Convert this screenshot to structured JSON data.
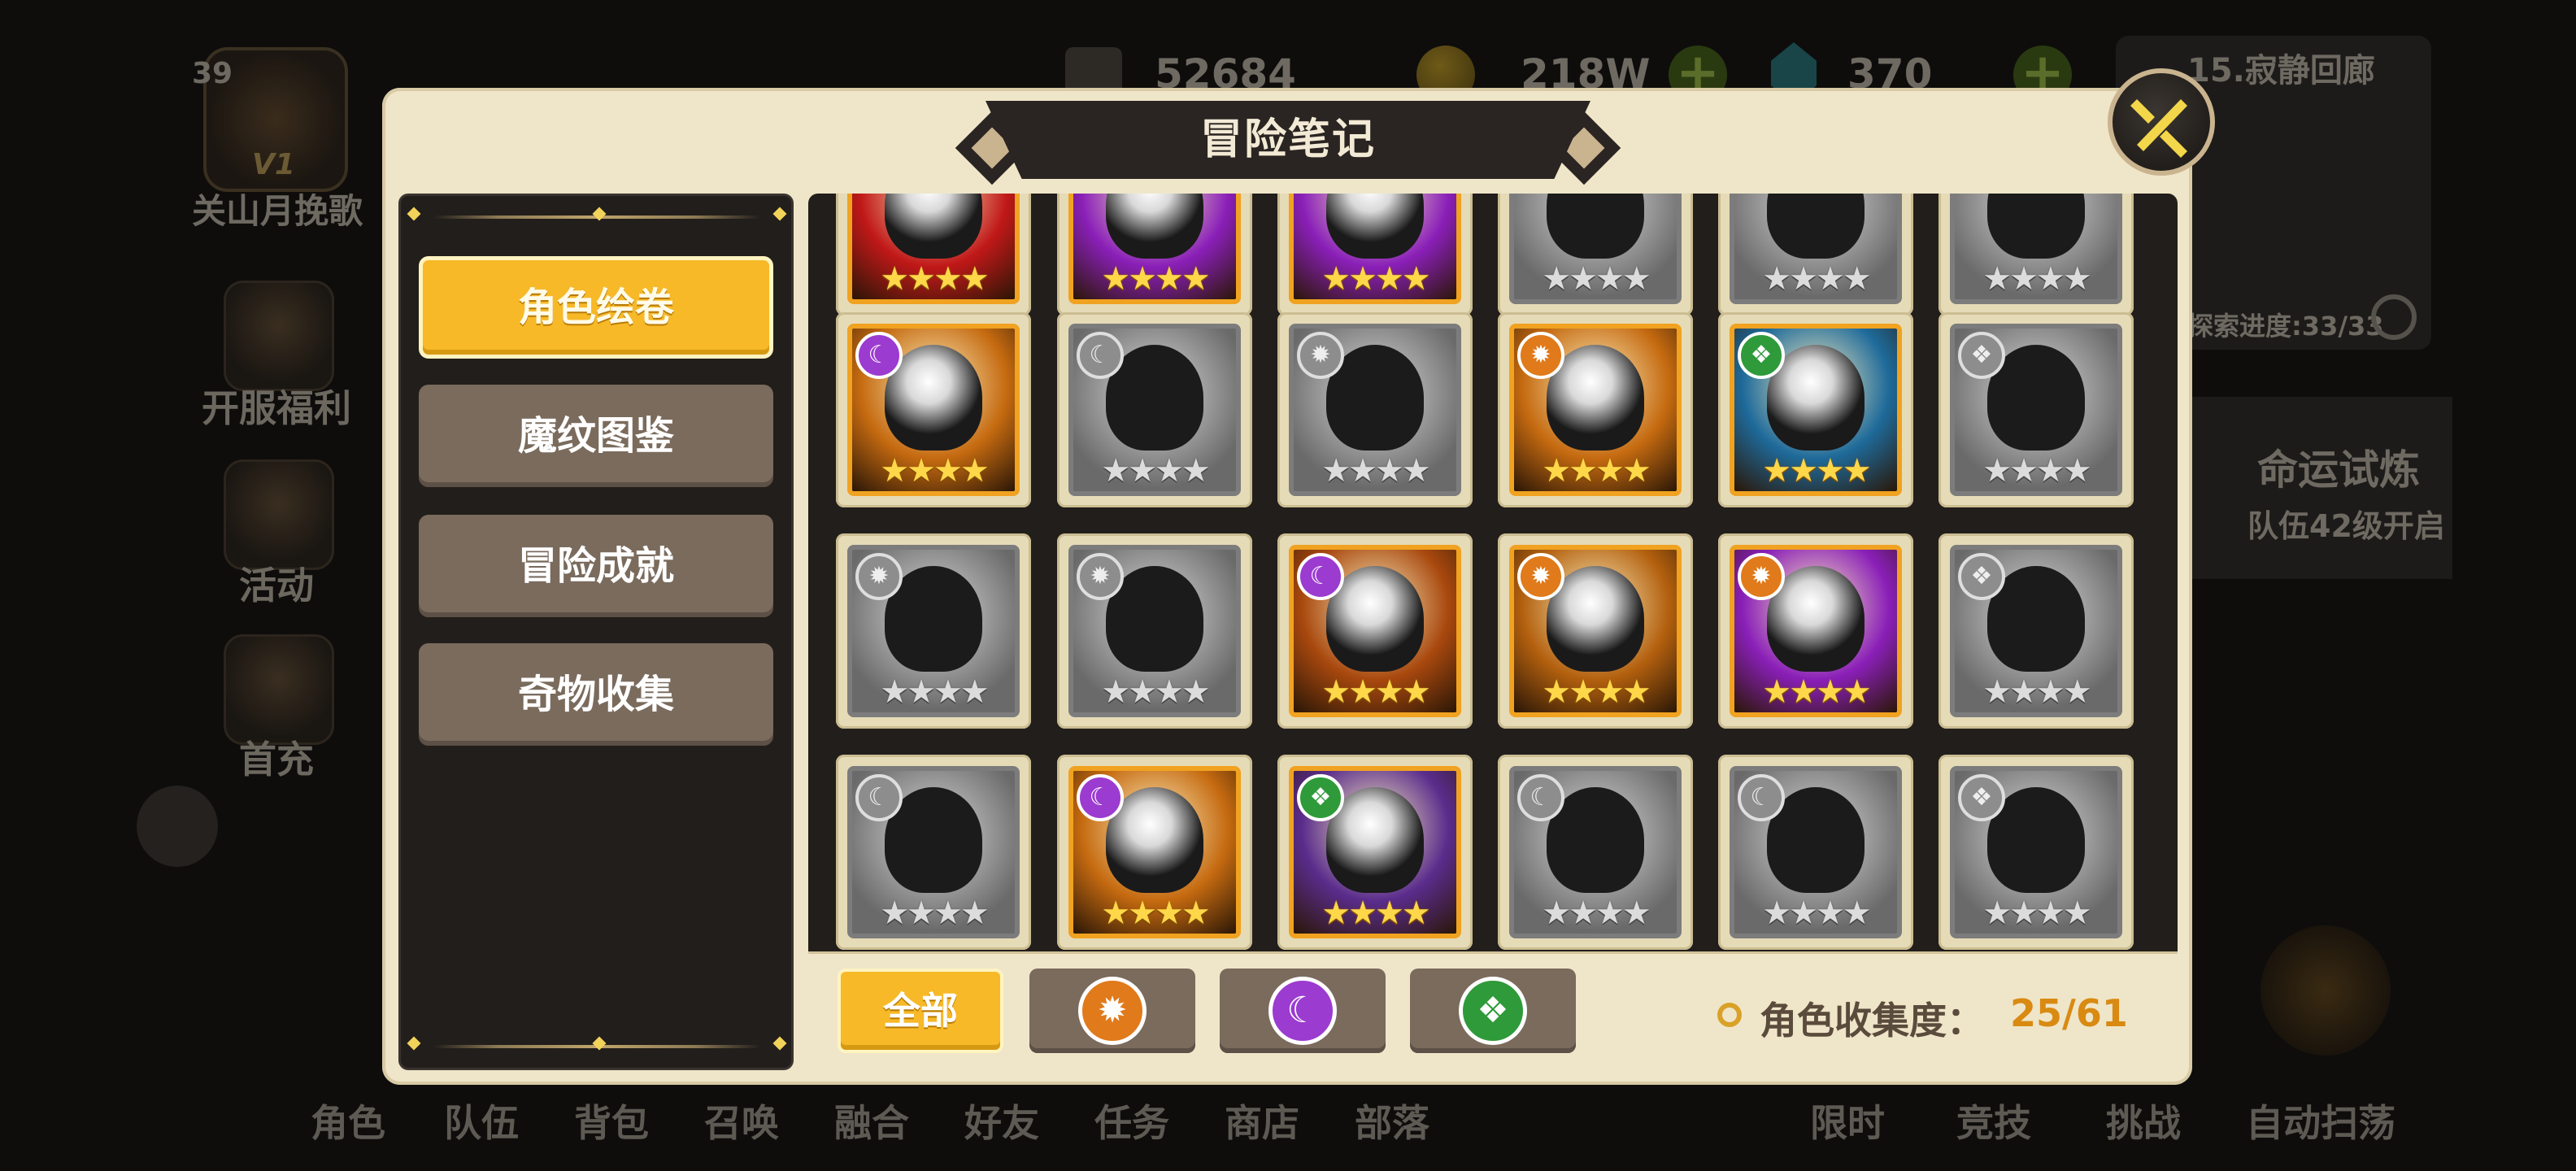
{
  "hud": {
    "player_level": "39",
    "vip_label": "V1",
    "player_name": "关山月挽歌",
    "power": "52684",
    "gold": "218W",
    "gems": "370",
    "stage_name": "15.寂静回廊",
    "explore_progress": "探索进度:33/33",
    "fate_trial_title": "命运试炼",
    "fate_trial_hint": "队伍42级开启",
    "left_menu": [
      "开服福利",
      "活动",
      "首充"
    ],
    "bottom_nav": [
      "角色",
      "队伍",
      "背包",
      "召唤",
      "融合",
      "好友",
      "任务",
      "商店",
      "部落",
      "限时",
      "竞技",
      "挑战",
      "自动扫荡"
    ]
  },
  "modal": {
    "title": "冒险笔记",
    "tabs": [
      {
        "label": "角色绘卷",
        "active": true
      },
      {
        "label": "魔纹图鉴",
        "active": false
      },
      {
        "label": "冒险成就",
        "active": false
      },
      {
        "label": "奇物收集",
        "active": false
      }
    ],
    "filters": {
      "all_label": "全部",
      "factions": [
        {
          "icon": "sun-faction-icon",
          "color": "#e07a1a"
        },
        {
          "icon": "moon-faction-icon",
          "color": "#9b3bd0"
        },
        {
          "icon": "nature-faction-icon",
          "color": "#2f9a3a"
        }
      ]
    },
    "collection_label": "角色收集度：",
    "collection_value": "25/61",
    "colors": {
      "accent": "#f7b928",
      "panel": "#221e1b",
      "frame": "#efe6c9",
      "owned_border": "#f0a220"
    }
  },
  "cards": [
    {
      "state": "owned",
      "faction": "none",
      "bg": "#c01818",
      "stars": "★★★★"
    },
    {
      "state": "owned",
      "faction": "none",
      "bg": "#8a1fb8",
      "stars": "★★★★"
    },
    {
      "state": "owned",
      "faction": "none",
      "bg": "#8a1fb8",
      "stars": "★★★★"
    },
    {
      "state": "locked",
      "faction": "none",
      "stars": "★★★★"
    },
    {
      "state": "locked",
      "faction": "none",
      "stars": "★★★★"
    },
    {
      "state": "locked",
      "faction": "none",
      "stars": "★★★★"
    },
    {
      "state": "owned",
      "faction": "moon",
      "bg": "#c56a10",
      "stars": "★★★★"
    },
    {
      "state": "locked",
      "faction": "moon",
      "stars": "★★★★"
    },
    {
      "state": "locked",
      "faction": "sun",
      "stars": "★★★★"
    },
    {
      "state": "owned",
      "faction": "sun",
      "bg": "#c56a10",
      "stars": "★★★★"
    },
    {
      "state": "owned",
      "faction": "nature",
      "bg": "#1e6a9a",
      "stars": "★★★★"
    },
    {
      "state": "locked",
      "faction": "nature",
      "stars": "★★★★"
    },
    {
      "state": "locked",
      "faction": "sun",
      "stars": "★★★★"
    },
    {
      "state": "locked",
      "faction": "sun",
      "stars": "★★★★"
    },
    {
      "state": "owned",
      "faction": "moon",
      "bg": "#a8480e",
      "stars": "★★★★"
    },
    {
      "state": "owned",
      "faction": "sun",
      "bg": "#b3600e",
      "stars": "★★★★"
    },
    {
      "state": "owned",
      "faction": "sun",
      "bg": "#8a1fb8",
      "stars": "★★★★"
    },
    {
      "state": "locked",
      "faction": "nature",
      "stars": "★★★★"
    },
    {
      "state": "locked",
      "faction": "moon",
      "stars": "★★★★"
    },
    {
      "state": "owned",
      "faction": "moon",
      "bg": "#c56a10",
      "stars": "★★★★"
    },
    {
      "state": "owned",
      "faction": "nature",
      "bg": "#5a2c8c",
      "stars": "★★★★"
    },
    {
      "state": "locked",
      "faction": "moon",
      "stars": "★★★★"
    },
    {
      "state": "locked",
      "faction": "moon",
      "stars": "★★★★"
    },
    {
      "state": "locked",
      "faction": "nature",
      "stars": "★★★★"
    }
  ]
}
